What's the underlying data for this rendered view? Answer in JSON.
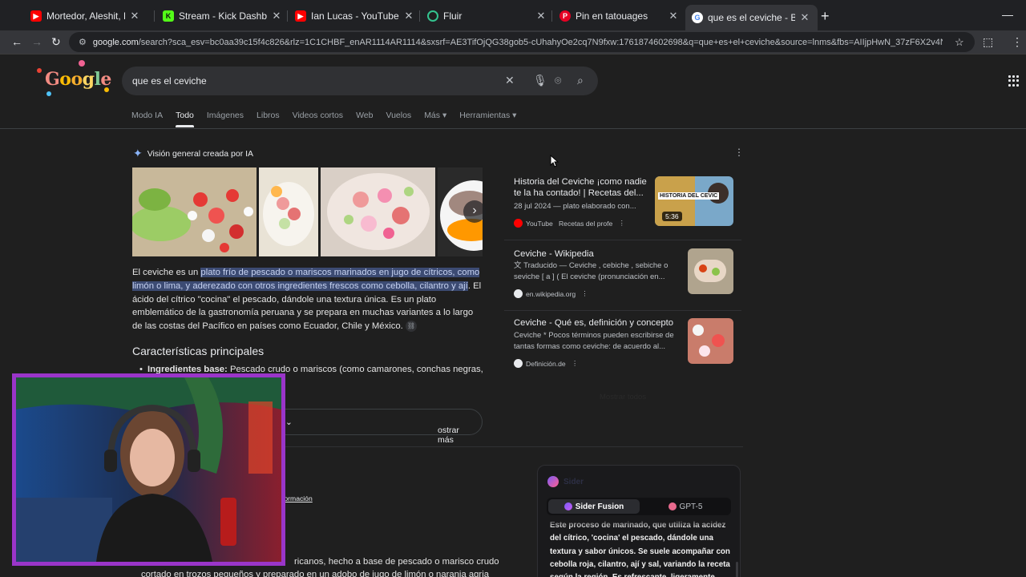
{
  "browser": {
    "tabs": [
      {
        "title": "Mortedor, Aleshit, LA MAFIA C",
        "favicon": "youtube-icon",
        "color": "#ff0000"
      },
      {
        "title": "Stream - Kick Dashboard",
        "favicon": "kick-icon",
        "color": "#53fc18"
      },
      {
        "title": "Ian Lucas - YouTube",
        "favicon": "youtube-icon",
        "color": "#ff0000"
      },
      {
        "title": "Fluir",
        "favicon": "fluir-icon",
        "color": "#34c38f"
      },
      {
        "title": "Pin en tatouages",
        "favicon": "pinterest-icon",
        "color": "#e60023"
      },
      {
        "title": "que es el ceviche - Buscar con G",
        "favicon": "google-icon",
        "color": "#8ab4f8",
        "active": true
      }
    ],
    "url_host": "google.com",
    "url_rest": "/search?sca_esv=bc0aa39c15f4c826&rlz=1C1CHBF_enAR1114AR1114&sxsrf=AE3TifOjQG38gob5-cUhahyOe2cq7N9fxw:1761874602698&q=que+es+el+ceviche&source=lnms&fbs=AIIjpHwN_37zF6X2v4NWekzskccOhfyrckUo5PQdKSt4N..."
  },
  "search": {
    "query": "que es el ceviche",
    "tabs": [
      "Modo IA",
      "Todo",
      "Imágenes",
      "Libros",
      "Videos cortos",
      "Web",
      "Vuelos",
      "Más ▾",
      "Herramientas ▾"
    ],
    "active_tab": "Todo"
  },
  "overview": {
    "heading": "Visión general creada por IA",
    "para_start": "El ceviche es un ",
    "para_highlight": "plato frío de pescado o mariscos marinados en jugo de cítricos, como limón o lima, y aderezado con otros ingredientes frescos como cebolla, cilantro y ají",
    "para_end": ". El ácido del cítrico \"cocina\" el pescado, dándole una textura única. Es un plato emblemático de la gastronomía peruana y se prepara en muchas variantes a lo largo de las costas del Pacífico en países como Ecuador, Chile y México.",
    "section_title": "Características principales",
    "bullet_label": "Ingredientes base:",
    "bullet_text": " Pescado crudo o mariscos (como camarones, conchas negras,",
    "show_more": "ostrar más"
  },
  "sources": [
    {
      "title": "Historia del Ceviche ¡como nadie te la ha contado! | Recetas del...",
      "desc": "28 jul 2024 — plato elaborado con...",
      "site": "YouTube",
      "site2": "Recetas del profe",
      "duration": "5:36",
      "thumb_label": "HISTORIA DEL CEVIC"
    },
    {
      "title": "Ceviche - Wikipedia",
      "desc_prefix": "Traducido — ",
      "desc": "Ceviche , cebiche , sebiche o seviche [ a ] ( El ceviche (pronunciación en...",
      "site": "en.wikipedia.org"
    },
    {
      "title": "Ceviche - Qué es, definición y concepto",
      "desc": "Ceviche * Pocos términos pueden escribirse de tantas formas como ceviche: de acuerdo al...",
      "site": "Definición.de"
    }
  ],
  "show_all": "Mostrar todos",
  "sider": {
    "brand": "Sider",
    "tab_a": "Sider Fusion",
    "tab_b": "GPT-5",
    "text": "Este proceso de marinado, que utiliza la acidez del cítrico, 'cocina' el pescado, dándole una textura y sabor únicos. Se suele acompañar con cebolla roja, cilantro, ají y sal, variando la receta según la región. Es refrescante, ligeramente"
  },
  "lower": {
    "link": "formación",
    "line1": "ricanos, hecho a base de pescado o marisco crudo",
    "line2": "cortado en trozos pequeños y preparado en un adobo de jugo de limón o naranja agria"
  },
  "colors": {
    "bg": "#1f1f1f",
    "accent": "#8ab4f8",
    "highlight": "#3c4b73",
    "webcam_border": "#9a35c9"
  }
}
